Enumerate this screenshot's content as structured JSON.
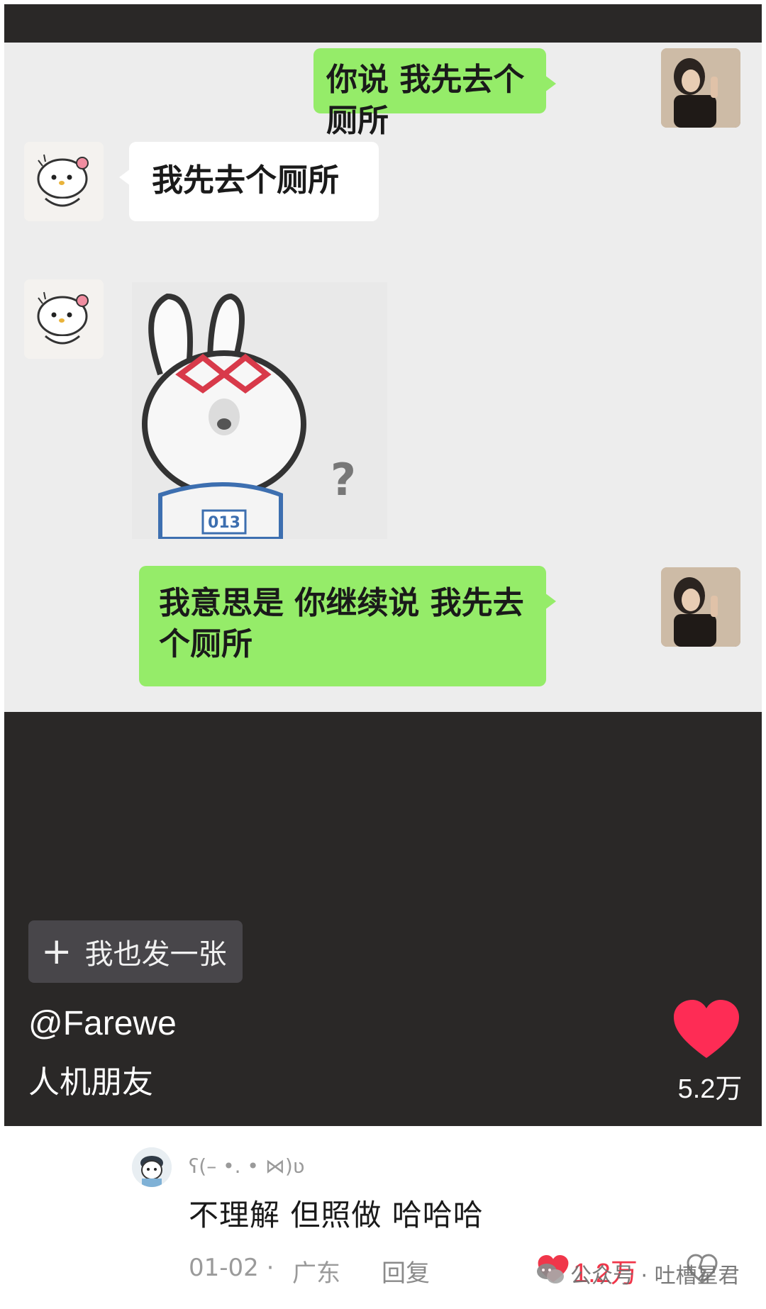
{
  "chat": {
    "messages": [
      {
        "side": "right",
        "text": "你说 我先去个厕所"
      },
      {
        "side": "left",
        "text": "我先去个厕所"
      },
      {
        "side": "left",
        "type": "sticker",
        "sticker_text": "013",
        "sticker_mark": "?"
      },
      {
        "side": "right",
        "text": "我意思是 你继续说 我先去个厕所"
      }
    ]
  },
  "post": {
    "post_button": "我也发一张",
    "author": "@Farewe",
    "title": "人机朋友",
    "like_count": "5.2万",
    "like_color": "#fe2c55"
  },
  "comment": {
    "username": "ʕ(– •. • ⋈)ʋ",
    "text": "不理解  但照做  哈哈哈",
    "date": "01-02 ·",
    "location": "广东",
    "reply": "回复",
    "likes": "1.2万"
  },
  "watermark": {
    "text": "公众号 · 吐槽星君"
  },
  "colors": {
    "green_bubble": "#95ec69",
    "dark_bg": "#2a2827"
  }
}
